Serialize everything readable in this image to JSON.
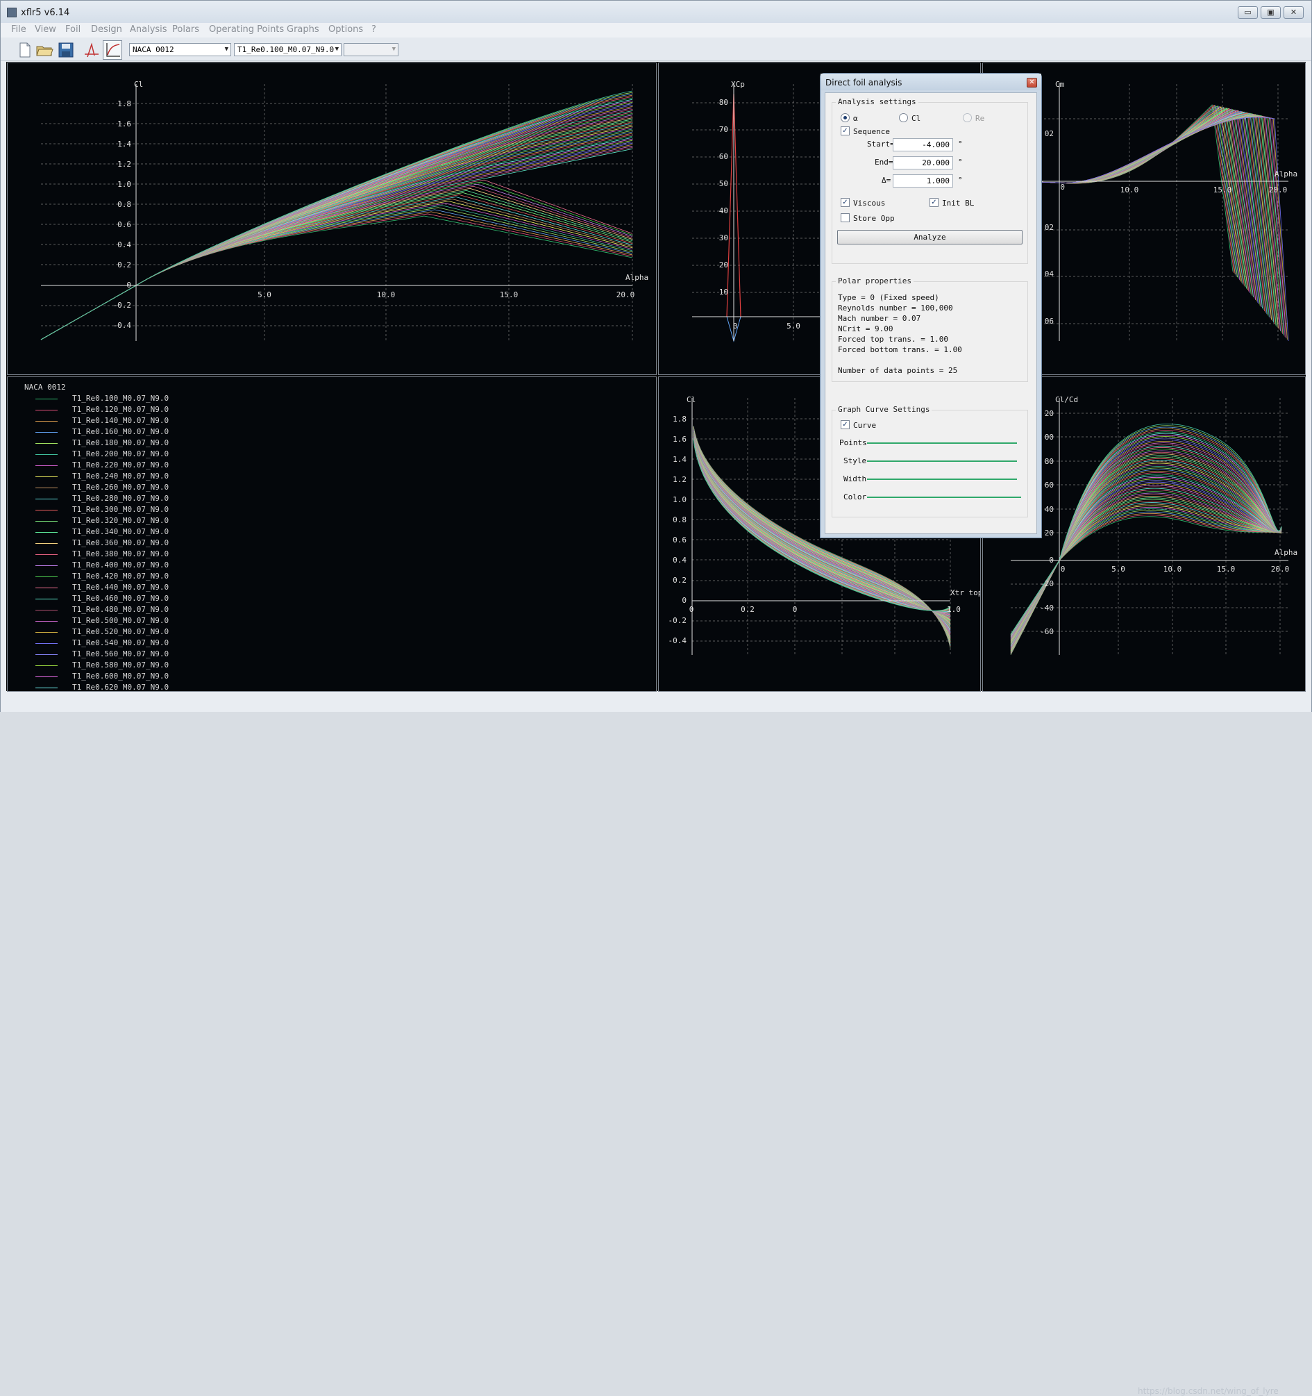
{
  "window": {
    "title": "xflr5 v6.14",
    "min_label": "▭",
    "max_label": "▣",
    "close_label": "✕"
  },
  "menu": [
    "File",
    "View",
    "Foil",
    "Design",
    "Analysis",
    "Polars",
    "Operating Points",
    "Graphs",
    "Options",
    "?"
  ],
  "toolbar": {
    "foil_combo": "NACA 0012",
    "polar_combo": "T1_Re0.100_M0.07_N9.0",
    "opp_combo": ""
  },
  "plots": {
    "cl_alpha": {
      "ylabel": "Cl",
      "xlabel": "Alpha",
      "yticks": [
        "1.8",
        "1.6",
        "1.4",
        "1.2",
        "1.0",
        "0.8",
        "0.6",
        "0.4",
        "0.2",
        "0",
        "-0.2",
        "-0.4"
      ],
      "xticks": [
        "5.0",
        "10.0",
        "15.0",
        "20.0"
      ]
    },
    "xcp": {
      "ylabel": "XCp",
      "yticks": [
        "80",
        "70",
        "60",
        "50",
        "40",
        "30",
        "20",
        "10"
      ],
      "xticks": [
        "0",
        "5.0"
      ]
    },
    "cm": {
      "ylabel": "Cm",
      "xlabel": "Alpha",
      "yticks": [
        "02",
        "0",
        "02",
        "04",
        "06"
      ],
      "xticks": [
        "0",
        "10.0",
        "15.0",
        "20.0"
      ]
    },
    "cl_xtr": {
      "ylabel": "Cl",
      "xlabel": "Xtr top",
      "yticks": [
        "1.8",
        "1.6",
        "1.4",
        "1.2",
        "1.0",
        "0.8",
        "0.6",
        "0.4",
        "0.2",
        "0",
        "-0.2",
        "-0.4"
      ],
      "xticks": [
        "0",
        "0.2",
        "0",
        "1.0"
      ]
    },
    "clcd": {
      "ylabel": "Cl/Cd",
      "xlabel": "Alpha",
      "yticks": [
        "20",
        "00",
        "80",
        "60",
        "40",
        "20",
        "0",
        "-20",
        "-40",
        "-60"
      ],
      "xticks": [
        "0",
        "5.0",
        "10.0",
        "15.0",
        "20.0"
      ]
    }
  },
  "legend": {
    "title": "NACA 0012",
    "items": [
      {
        "label": "T1_Re0.100_M0.07_N9.0",
        "color": "#2fbf71"
      },
      {
        "label": "T1_Re0.120_M0.07_N9.0",
        "color": "#e0507a"
      },
      {
        "label": "T1_Re0.140_M0.07_N9.0",
        "color": "#e0a050"
      },
      {
        "label": "T1_Re0.160_M0.07_N9.0",
        "color": "#60a0f0"
      },
      {
        "label": "T1_Re0.180_M0.07_N9.0",
        "color": "#a0e060"
      },
      {
        "label": "T1_Re0.200_M0.07_N9.0",
        "color": "#40c0a0"
      },
      {
        "label": "T1_Re0.220_M0.07_N9.0",
        "color": "#d060d0"
      },
      {
        "label": "T1_Re0.240_M0.07_N9.0",
        "color": "#f0f060"
      },
      {
        "label": "T1_Re0.260_M0.07_N9.0",
        "color": "#c09060"
      },
      {
        "label": "T1_Re0.280_M0.07_N9.0",
        "color": "#60e0e0"
      },
      {
        "label": "T1_Re0.300_M0.07_N9.0",
        "color": "#f06060"
      },
      {
        "label": "T1_Re0.320_M0.07_N9.0",
        "color": "#80f080"
      },
      {
        "label": "T1_Re0.340_M0.07_N9.0",
        "color": "#60f0a0"
      },
      {
        "label": "T1_Re0.360_M0.07_N9.0",
        "color": "#f0d080"
      },
      {
        "label": "T1_Re0.380_M0.07_N9.0",
        "color": "#e06080"
      },
      {
        "label": "T1_Re0.400_M0.07_N9.0",
        "color": "#c080f0"
      },
      {
        "label": "T1_Re0.420_M0.07_N9.0",
        "color": "#50d050"
      },
      {
        "label": "T1_Re0.440_M0.07_N9.0",
        "color": "#f07090"
      },
      {
        "label": "T1_Re0.460_M0.07_N9.0",
        "color": "#60f0d0"
      },
      {
        "label": "T1_Re0.480_M0.07_N9.0",
        "color": "#b05070"
      },
      {
        "label": "T1_Re0.500_M0.07_N9.0",
        "color": "#e070e0"
      },
      {
        "label": "T1_Re0.520_M0.07_N9.0",
        "color": "#d0b040"
      },
      {
        "label": "T1_Re0.540_M0.07_N9.0",
        "color": "#7070f0"
      },
      {
        "label": "T1_Re0.560_M0.07_N9.0",
        "color": "#8080f0"
      },
      {
        "label": "T1_Re0.580_M0.07_N9.0",
        "color": "#a0e040"
      },
      {
        "label": "T1_Re0.600_M0.07_N9.0",
        "color": "#f070f0"
      },
      {
        "label": "T1_Re0.620_M0.07_N9.0",
        "color": "#70f0f0"
      }
    ]
  },
  "dialog": {
    "title": "Direct foil analysis",
    "analysis_settings": {
      "title": "Analysis settings",
      "radio_alpha": "α",
      "radio_cl": "Cl",
      "radio_re": "Re",
      "sequence": "Sequence",
      "start_label": "Start=",
      "start_value": "-4.000",
      "end_label": "End=",
      "end_value": "20.000",
      "delta_label": "Δ=",
      "delta_value": "1.000",
      "deg": "°",
      "viscous": "Viscous",
      "init_bl": "Init BL",
      "store_opp": "Store Opp",
      "analyze": "Analyze"
    },
    "polar_properties": {
      "title": "Polar properties",
      "lines": [
        "Type = 0 (Fixed speed)",
        "Reynolds number = 100,000",
        "Mach number =  0.07",
        "NCrit =   9.00",
        "Forced top trans.    =   1.00",
        "Forced bottom trans. =   1.00",
        "",
        "Number of data points = 25"
      ]
    },
    "curve_settings": {
      "title": "Graph Curve Settings",
      "curve": "Curve",
      "points": "Points",
      "style": "Style",
      "width": "Width",
      "color": "Color",
      "line_color": "#2fa86a"
    }
  },
  "status": {
    "watermark": "https://blog.csdn.net/wing_of_lyre"
  }
}
